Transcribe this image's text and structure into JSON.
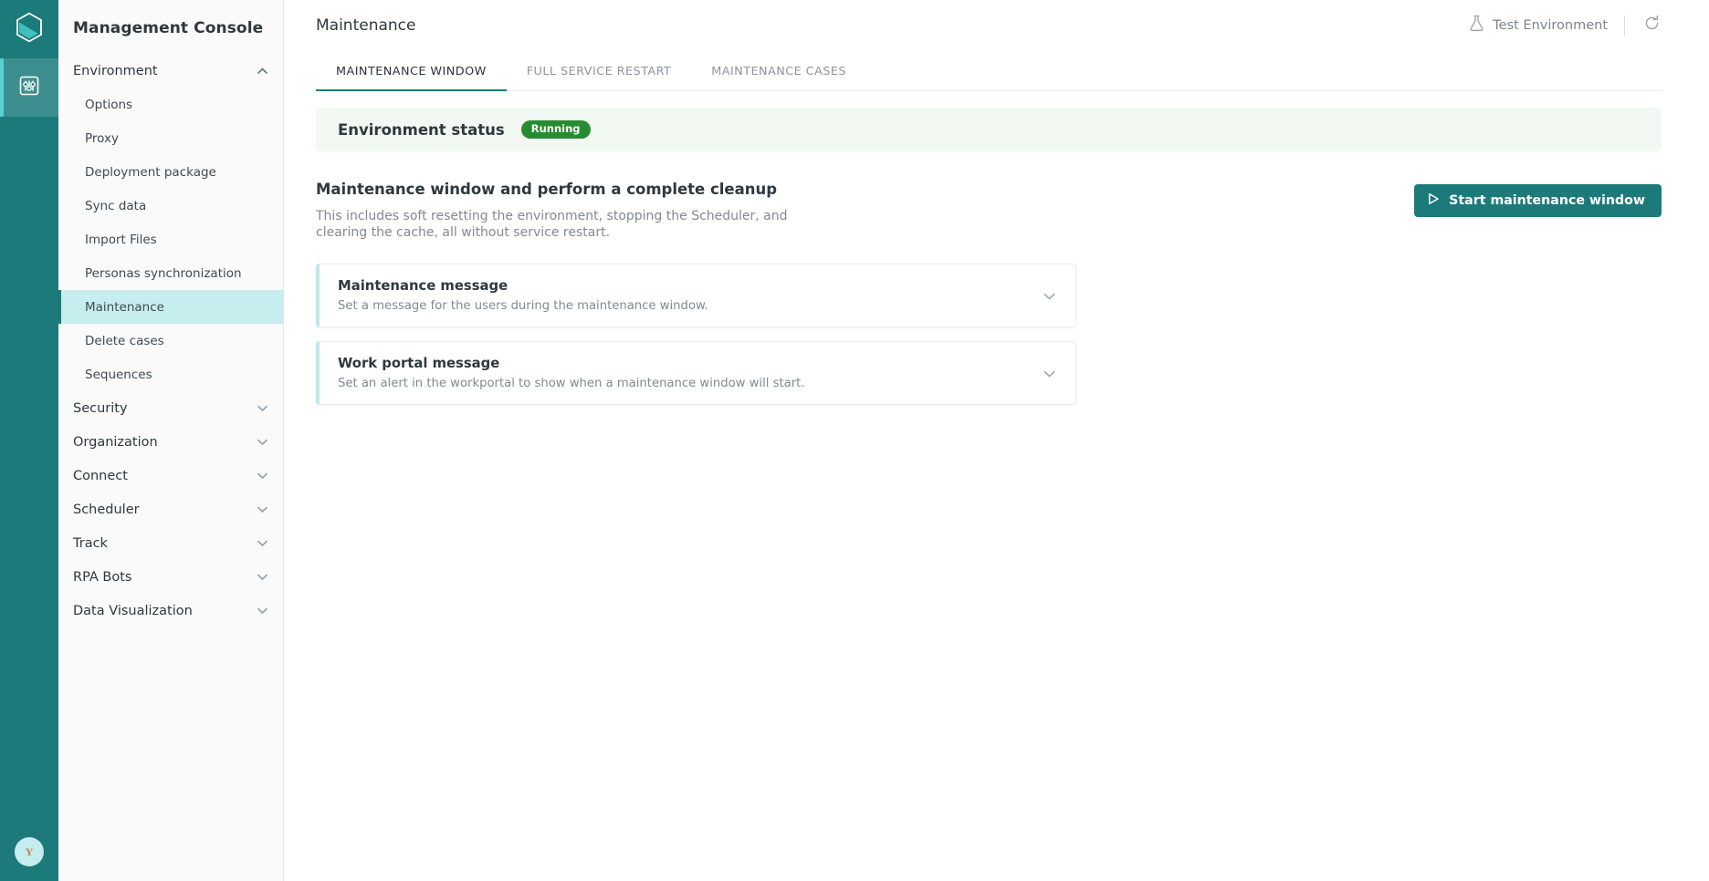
{
  "rail": {
    "logo_icon": "hexagon-logo-icon",
    "items": [
      {
        "icon": "sliders-settings-icon",
        "active": true
      }
    ],
    "avatar": {
      "initial": "Y",
      "name": "user-avatar"
    }
  },
  "sidebar": {
    "title": "Management Console",
    "nav": [
      {
        "label": "Environment",
        "type": "group",
        "expanded": true,
        "chevron": "chevron-up-icon",
        "items": [
          {
            "label": "Options",
            "active": false
          },
          {
            "label": "Proxy",
            "active": false
          },
          {
            "label": "Deployment package",
            "active": false
          },
          {
            "label": "Sync data",
            "active": false
          },
          {
            "label": "Import Files",
            "active": false
          },
          {
            "label": "Personas synchronization",
            "active": false
          },
          {
            "label": "Maintenance",
            "active": true
          },
          {
            "label": "Delete cases",
            "active": false
          },
          {
            "label": "Sequences",
            "active": false
          }
        ]
      },
      {
        "label": "Security",
        "type": "group",
        "expanded": false,
        "chevron": "chevron-down-icon",
        "items": []
      },
      {
        "label": "Organization",
        "type": "group",
        "expanded": false,
        "chevron": "chevron-down-icon",
        "items": []
      },
      {
        "label": "Connect",
        "type": "group",
        "expanded": false,
        "chevron": "chevron-down-icon",
        "items": []
      },
      {
        "label": "Scheduler",
        "type": "group",
        "expanded": false,
        "chevron": "chevron-down-icon",
        "items": []
      },
      {
        "label": "Track",
        "type": "group",
        "expanded": false,
        "chevron": "chevron-down-icon",
        "items": []
      },
      {
        "label": "RPA Bots",
        "type": "group",
        "expanded": false,
        "chevron": "chevron-down-icon",
        "items": []
      },
      {
        "label": "Data Visualization",
        "type": "group",
        "expanded": false,
        "chevron": "chevron-down-icon",
        "items": []
      }
    ]
  },
  "header": {
    "title": "Maintenance",
    "environment_label": "Test Environment",
    "environment_icon": "flask-icon",
    "refresh_icon": "refresh-icon"
  },
  "tabs": [
    {
      "label": "MAINTENANCE WINDOW",
      "active": true
    },
    {
      "label": "FULL SERVICE RESTART",
      "active": false
    },
    {
      "label": "MAINTENANCE CASES",
      "active": false
    }
  ],
  "status": {
    "label": "Environment status",
    "badge": "Running",
    "badge_color": "#258c32",
    "card_bg": "#f2f8f2"
  },
  "section": {
    "title": "Maintenance window and perform a complete cleanup",
    "description": "This includes soft resetting the environment, stopping the Scheduler, and clearing the cache, all without service restart.",
    "button_label": "Start maintenance window",
    "button_icon": "play-icon",
    "button_color": "#1c7a7a"
  },
  "panels": [
    {
      "title": "Maintenance message",
      "description": "Set a message for the users during the maintenance window.",
      "chevron": "chevron-down-icon",
      "expanded": false
    },
    {
      "title": "Work portal message",
      "description": "Set an alert in the workportal to show when a maintenance window will start.",
      "chevron": "chevron-down-icon",
      "expanded": false
    }
  ],
  "colors": {
    "brand_teal": "#1c7a7a",
    "accent_cyan": "#57d1cf",
    "active_nav_bg": "#c7eeef",
    "text_primary": "#2f383e",
    "text_muted": "#818a90"
  }
}
